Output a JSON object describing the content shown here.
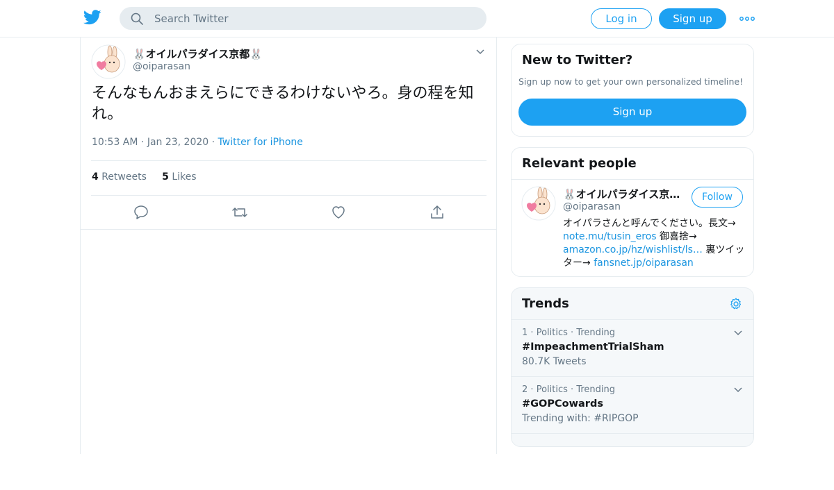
{
  "header": {
    "search_placeholder": "Search Twitter",
    "login_label": "Log in",
    "signup_label": "Sign up",
    "brand_color": "#1da1f2"
  },
  "tweet": {
    "display_name": "🐰オイルパラダイス京都🐰",
    "handle": "@oiparasan",
    "text": "そんなもんおまえらにできるわけないやろ。身の程を知れ。",
    "time": "10:53 AM",
    "date": "Jan 23, 2020",
    "source": "Twitter for iPhone",
    "retweets_count": "4",
    "retweets_label": "Retweets",
    "likes_count": "5",
    "likes_label": "Likes",
    "dot": "·"
  },
  "new_to_twitter": {
    "title": "New to Twitter?",
    "subtitle": "Sign up now to get your own personalized timeline!",
    "button": "Sign up"
  },
  "relevant_people": {
    "title": "Relevant people",
    "name": "🐰オイルパラダイス京都🐰",
    "handle": "@oiparasan",
    "follow_label": "Follow",
    "bio_1": "オイパラさんと呼んでください。長文→ ",
    "link_1": "note.mu/tusin_eros",
    "bio_2": " 御喜捨→ ",
    "link_2": "amazon.co.jp/hz/wishlist/ls…",
    "bio_3": " 裏ツイッター→ ",
    "link_3": "fansnet.jp/oiparasan"
  },
  "trends": {
    "title": "Trends",
    "items": [
      {
        "rank": "1",
        "category": "Politics",
        "status": "Trending",
        "name": "#ImpeachmentTrialSham",
        "sub": "80.7K Tweets"
      },
      {
        "rank": "2",
        "category": "Politics",
        "status": "Trending",
        "name": "#GOPCowards",
        "sub": "Trending with: #RIPGOP"
      }
    ]
  }
}
